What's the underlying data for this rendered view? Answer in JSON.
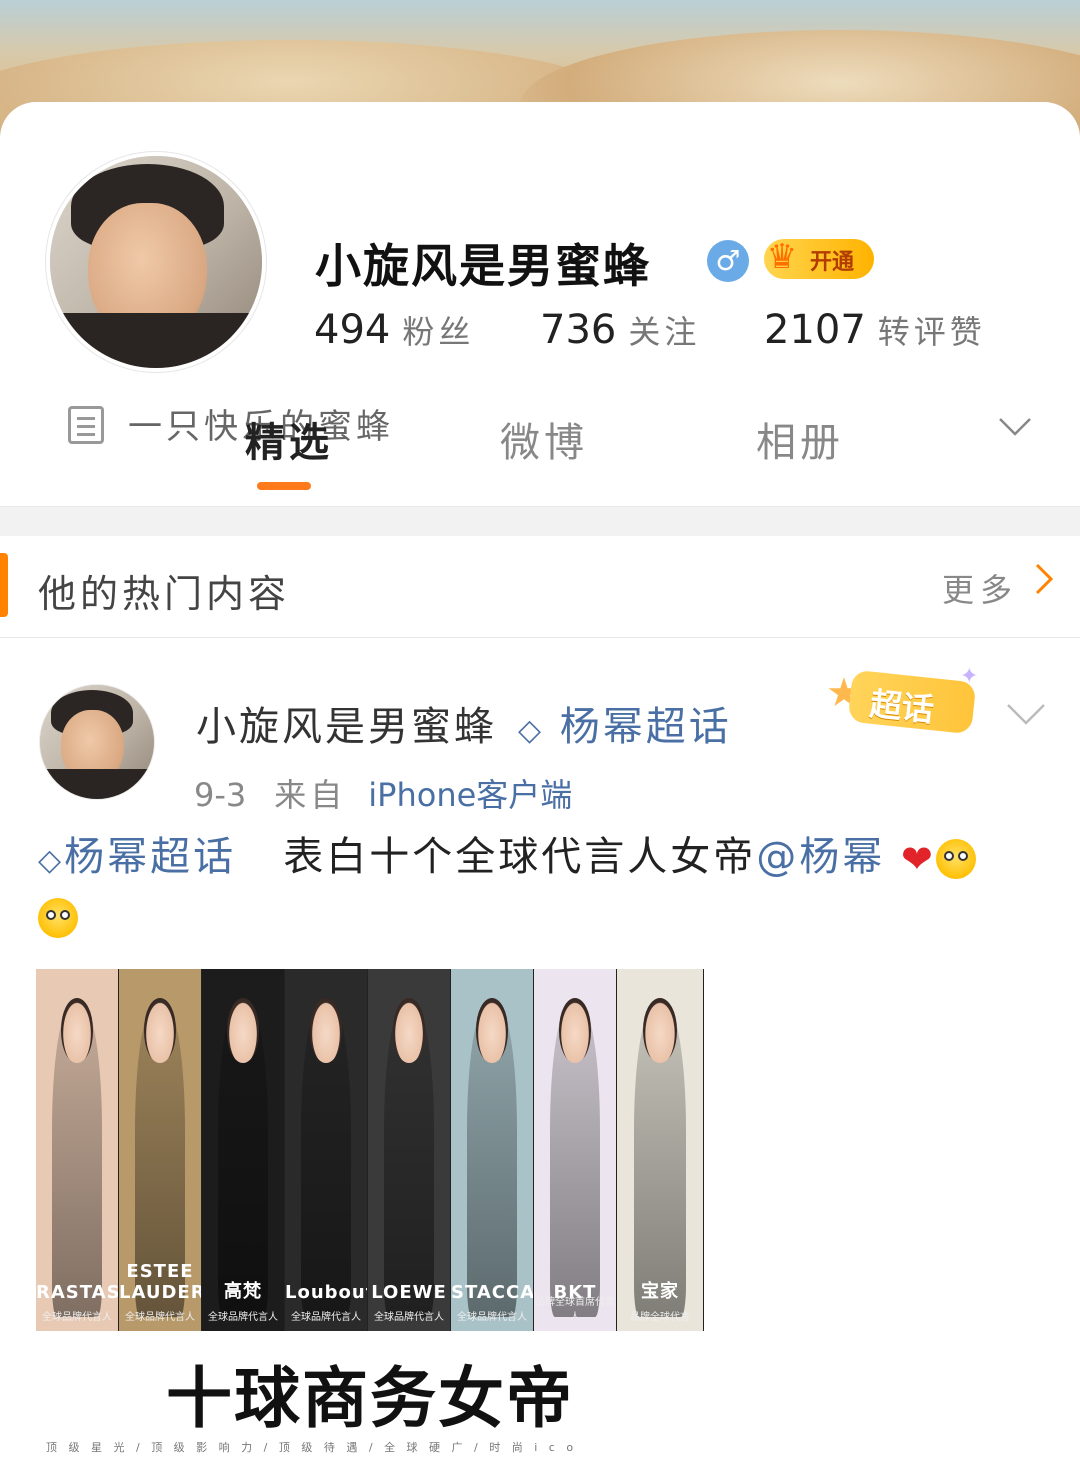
{
  "profile": {
    "name": "小旋风是男蜜蜂",
    "gender_symbol": "♂",
    "vip_label": "开通",
    "stats": [
      {
        "value": "494",
        "label": "粉丝"
      },
      {
        "value": "736",
        "label": "关注"
      },
      {
        "value": "2107",
        "label": "转评赞"
      }
    ],
    "bio": "一只快乐的蜜蜂"
  },
  "tabs": [
    {
      "label": "精选",
      "active": true
    },
    {
      "label": "微博",
      "active": false
    },
    {
      "label": "相册",
      "active": false
    }
  ],
  "section": {
    "title": "他的热门内容",
    "more_label": "更多"
  },
  "post": {
    "author": "小旋风是男蜜蜂",
    "topic": "杨幂超话",
    "badge_label": "超话",
    "date": "9-3",
    "from_label": "来自",
    "source": "iPhone客户端",
    "body_topic": "杨幂超话",
    "body_text": "表白十个全球代言人女帝",
    "mention": "@杨幂",
    "image": {
      "panels": [
        {
          "brand": "RASTAS",
          "caption": "全球品牌代言人",
          "color": "#e8c9b3"
        },
        {
          "brand": "ESTEE LAUDER",
          "caption": "全球品牌代言人",
          "color": "#b89a6a"
        },
        {
          "brand": "高梵",
          "caption": "全球品牌代言人",
          "color": "#1c1c1c"
        },
        {
          "brand": "Louboutin",
          "caption": "全球品牌代言人",
          "color": "#2a2a2a"
        },
        {
          "brand": "LOEWE",
          "caption": "全球品牌代言人",
          "color": "#3a3a3a"
        },
        {
          "brand": "STACCATO",
          "caption": "全球品牌代言人",
          "color": "#a9c2c8"
        },
        {
          "brand": "BKT",
          "caption": "品牌全球首席代言人",
          "color": "#ece4ee"
        },
        {
          "brand": "宝家",
          "caption": "品牌全球代言",
          "color": "#e9e5da"
        }
      ],
      "headline": "十球商务女帝",
      "tagline": "顶 级 星 光  /  顶 级 影 响 力  /  顶 级 待 遇  /  全 球 硬 广  /  时 尚 i c o"
    }
  },
  "colors": {
    "accent": "#ff8200",
    "link": "#4a6fa5"
  }
}
